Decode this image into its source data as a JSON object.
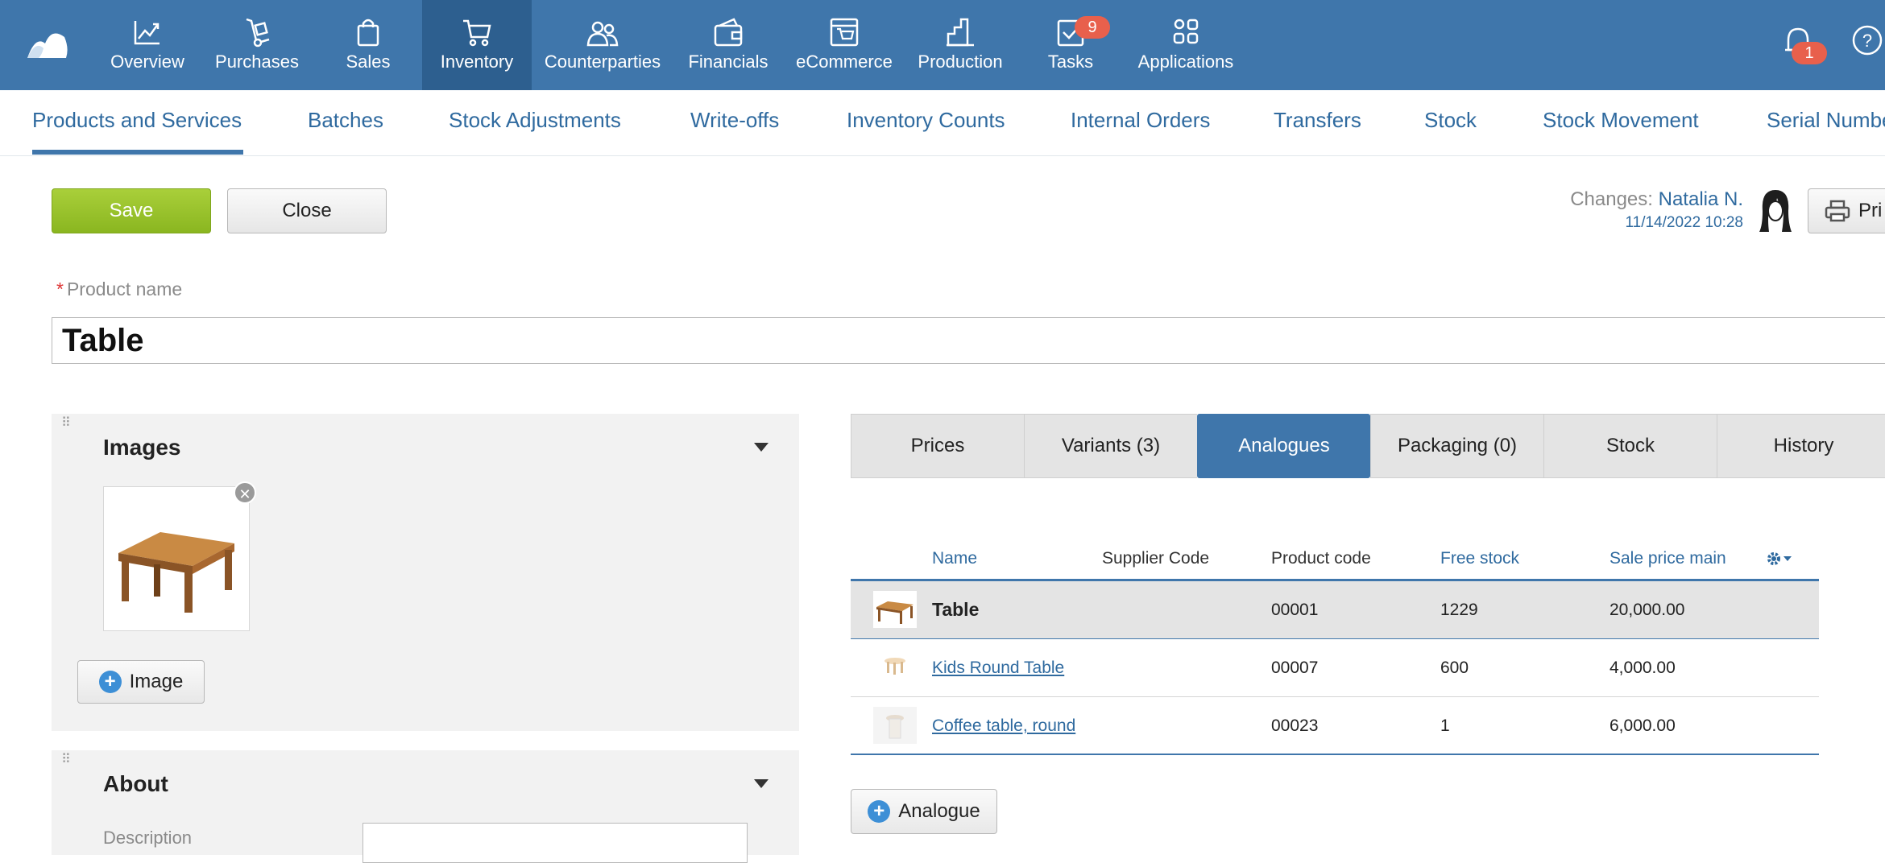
{
  "nav": {
    "items": [
      {
        "label": "Overview",
        "icon": "chart-line-icon"
      },
      {
        "label": "Purchases",
        "icon": "hand-truck-icon"
      },
      {
        "label": "Sales",
        "icon": "shopping-bag-icon"
      },
      {
        "label": "Inventory",
        "icon": "cart-icon",
        "active": true
      },
      {
        "label": "Counterparties",
        "icon": "people-icon"
      },
      {
        "label": "Financials",
        "icon": "wallet-icon"
      },
      {
        "label": "eCommerce",
        "icon": "shop-icon"
      },
      {
        "label": "Production",
        "icon": "factory-icon"
      },
      {
        "label": "Tasks",
        "icon": "checkbox-icon",
        "badge": "9"
      },
      {
        "label": "Applications",
        "icon": "apps-icon"
      }
    ],
    "notifications_badge": "1"
  },
  "subnav": {
    "tabs": [
      "Products and Services",
      "Batches",
      "Stock Adjustments",
      "Write-offs",
      "Inventory Counts",
      "Internal Orders",
      "Transfers",
      "Stock",
      "Stock Movement",
      "Serial Numbe"
    ]
  },
  "toolbar": {
    "save_label": "Save",
    "close_label": "Close",
    "changes_label": "Changes:",
    "changes_user": "Natalia N.",
    "changes_time": "11/14/2022 10:28",
    "print_label": "Pri"
  },
  "product": {
    "name_label": "Product name",
    "required_mark": "*",
    "name_value": "Table"
  },
  "images_panel": {
    "title": "Images",
    "add_image_label": "Image"
  },
  "about_panel": {
    "title": "About",
    "description_label": "Description"
  },
  "right_tabs": [
    "Prices",
    "Variants (3)",
    "Analogues",
    "Packaging (0)",
    "Stock",
    "History"
  ],
  "right_tabs_active": "Analogues",
  "analogues_table": {
    "headers": {
      "name": "Name",
      "supplier_code": "Supplier Code",
      "product_code": "Product code",
      "free_stock": "Free stock",
      "sale_price": "Sale price main"
    },
    "rows": [
      {
        "name": "Table",
        "product_code": "00001",
        "free_stock": "1229",
        "sale_price": "20,000.00"
      },
      {
        "name": "Kids Round Table",
        "product_code": "00007",
        "free_stock": "600",
        "sale_price": "4,000.00"
      },
      {
        "name": "Coffee table, round",
        "product_code": "00023",
        "free_stock": "1",
        "sale_price": "6,000.00"
      }
    ],
    "add_label": "Analogue"
  },
  "colors": {
    "nav_bg": "#3f76ab",
    "nav_active": "#2d5f8f",
    "accent_link": "#2f6a9f",
    "save_green": "#96c22b",
    "badge": "#e8604c"
  }
}
